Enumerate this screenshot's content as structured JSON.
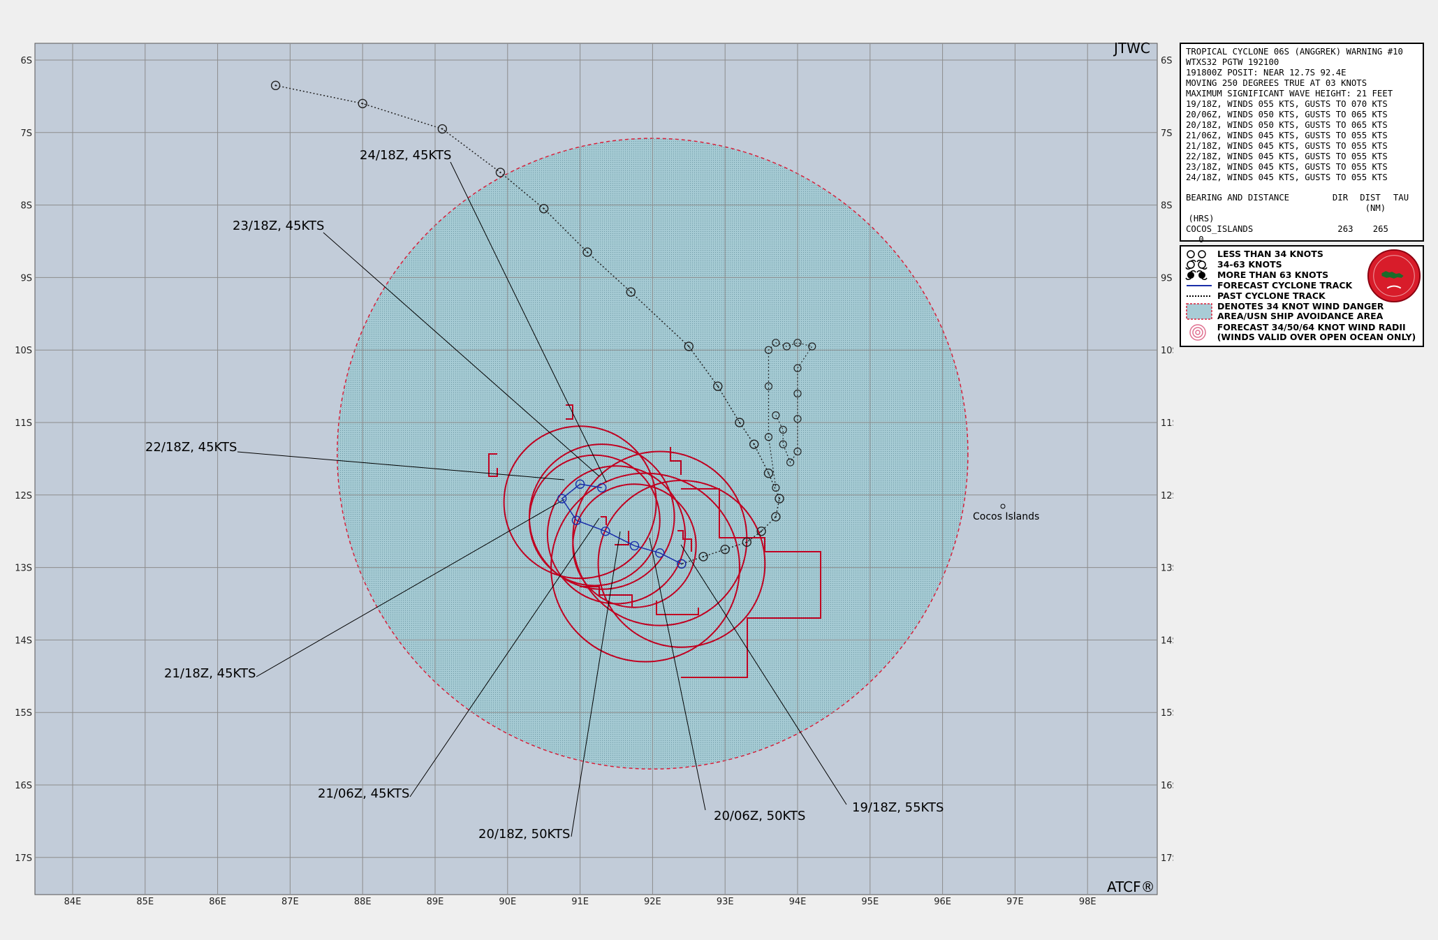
{
  "map": {
    "title_corner": "JTWC",
    "footer_corner": "ATCF®",
    "place_label": "Cocos Islands",
    "lon_labels": [
      "84E",
      "85E",
      "86E",
      "87E",
      "88E",
      "89E",
      "90E",
      "91E",
      "92E",
      "93E",
      "94E",
      "95E",
      "96E",
      "97E",
      "98E"
    ],
    "lat_labels": [
      "6S",
      "7S",
      "8S",
      "9S",
      "10S",
      "11S",
      "12S",
      "13S",
      "14S",
      "15S",
      "16S",
      "17S"
    ],
    "colors": {
      "ocean": "#c2ccd9",
      "danger_area": "#a8ccd6",
      "wind_radii": "#c00020",
      "forecast_track": "#1a2ea8",
      "grid": "#8c8c8c"
    },
    "forecast_labels": [
      {
        "id": "24-18z",
        "text": "24/18Z, 45KTS"
      },
      {
        "id": "23-18z",
        "text": "23/18Z, 45KTS"
      },
      {
        "id": "22-18z",
        "text": "22/18Z, 45KTS"
      },
      {
        "id": "21-18z",
        "text": "21/18Z, 45KTS"
      },
      {
        "id": "21-06z",
        "text": "21/06Z, 45KTS"
      },
      {
        "id": "20-18z",
        "text": "20/18Z, 50KTS"
      },
      {
        "id": "20-06z",
        "text": "20/06Z, 50KTS"
      },
      {
        "id": "19-18z",
        "text": "19/18Z, 55KTS"
      }
    ]
  },
  "warning": {
    "line1": "TROPICAL CYCLONE 06S (ANGGREK) WARNING #10",
    "line2": "WTXS32 PGTW 192100",
    "line3": "191800Z POSIT: NEAR 12.7S 92.4E",
    "line4": "MOVING 250 DEGREES TRUE AT 03 KNOTS",
    "line5": "MAXIMUM SIGNIFICANT WAVE HEIGHT: 21 FEET",
    "forecasts": [
      "19/18Z, WINDS 055 KTS, GUSTS TO 070 KTS",
      "20/06Z, WINDS 050 KTS, GUSTS TO 065 KTS",
      "20/18Z, WINDS 050 KTS, GUSTS TO 065 KTS",
      "21/06Z, WINDS 045 KTS, GUSTS TO 055 KTS",
      "21/18Z, WINDS 045 KTS, GUSTS TO 055 KTS",
      "22/18Z, WINDS 045 KTS, GUSTS TO 055 KTS",
      "23/18Z, WINDS 045 KTS, GUSTS TO 055 KTS",
      "24/18Z, WINDS 045 KTS, GUSTS TO 055 KTS"
    ],
    "bearing_header": "BEARING AND DISTANCE",
    "col_dir": "DIR",
    "col_dist": "DIST",
    "col_dist_unit": "(NM)",
    "col_tau": "TAU",
    "col_tau_unit": "(HRS)",
    "station": "COCOS_ISLANDS",
    "dir_value": "263",
    "dist_value": "265",
    "tau_value": "0"
  },
  "legend": {
    "items": [
      {
        "icon": "weak-cyclone-icon",
        "text": "LESS THAN 34 KNOTS"
      },
      {
        "icon": "moderate-cyclone-icon",
        "text": "34-63 KNOTS"
      },
      {
        "icon": "strong-cyclone-icon",
        "text": "MORE THAN 63 KNOTS"
      },
      {
        "icon": "forecast-track-icon",
        "text": "FORECAST CYCLONE TRACK"
      },
      {
        "icon": "past-track-icon",
        "text": "PAST CYCLONE TRACK"
      },
      {
        "icon": "danger-area-icon",
        "text": "DENOTES 34 KNOT WIND DANGER AREA/USN SHIP AVOIDANCE AREA"
      },
      {
        "icon": "wind-radii-icon",
        "text": "FORECAST 34/50/64 KNOT WIND RADII (WINDS VALID OVER OPEN OCEAN ONLY)"
      }
    ]
  },
  "track": {
    "past": [
      {
        "lon": 86.8,
        "lat": 6.35
      },
      {
        "lon": 88.0,
        "lat": 6.6
      },
      {
        "lon": 89.1,
        "lat": 6.95
      },
      {
        "lon": 89.9,
        "lat": 7.55
      },
      {
        "lon": 90.5,
        "lat": 8.05
      },
      {
        "lon": 91.1,
        "lat": 8.65
      },
      {
        "lon": 91.7,
        "lat": 9.2
      },
      {
        "lon": 92.5,
        "lat": 9.95
      },
      {
        "lon": 92.9,
        "lat": 10.5
      },
      {
        "lon": 93.2,
        "lat": 11.0
      },
      {
        "lon": 93.4,
        "lat": 11.3
      },
      {
        "lon": 93.6,
        "lat": 11.7
      },
      {
        "lon": 93.75,
        "lat": 12.05
      },
      {
        "lon": 93.7,
        "lat": 12.3
      },
      {
        "lon": 93.5,
        "lat": 12.5
      },
      {
        "lon": 93.3,
        "lat": 12.65
      },
      {
        "lon": 93.0,
        "lat": 12.75
      },
      {
        "lon": 92.7,
        "lat": 12.85
      },
      {
        "lon": 92.4,
        "lat": 12.95
      }
    ],
    "forecast": [
      {
        "lon": 92.4,
        "lat": 12.95
      },
      {
        "lon": 92.1,
        "lat": 12.8
      },
      {
        "lon": 91.75,
        "lat": 12.7
      },
      {
        "lon": 91.35,
        "lat": 12.5
      },
      {
        "lon": 90.95,
        "lat": 12.35
      },
      {
        "lon": 90.75,
        "lat": 12.05
      },
      {
        "lon": 91.0,
        "lat": 11.85
      },
      {
        "lon": 91.3,
        "lat": 11.9
      }
    ]
  }
}
